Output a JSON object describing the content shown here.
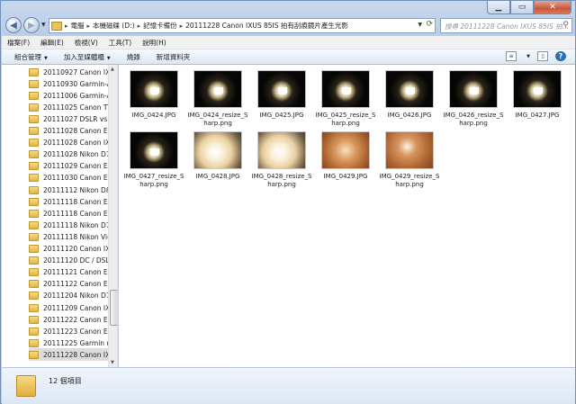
{
  "window": {
    "caption_buttons": [
      "minimize",
      "maximize",
      "close"
    ]
  },
  "address": {
    "crumbs": [
      "電腦",
      "本機磁碟 (D:)",
      "記憶卡備份",
      "20111228 Canon IXUS 85IS 拍有刮痕鏡片產生光影"
    ]
  },
  "search": {
    "placeholder": "搜尋 20111228 Canon IXUS 85IS 拍..."
  },
  "menu": {
    "items": [
      "檔案(F)",
      "編輯(E)",
      "檢視(V)",
      "工具(T)",
      "說明(H)"
    ]
  },
  "toolbar": {
    "organize": "組合管理",
    "add_to_library": "加入至媒體櫃",
    "burn": "燒錄",
    "new_folder": "新增資料夾"
  },
  "tree": {
    "items": [
      "20110927 Canon IX",
      "20110930 Garmin-A",
      "20111006 Garmin-A",
      "20111025 Canon TT",
      "20111027 DSLR vs D",
      "20111028 Canon EC",
      "20111028 Canon IX",
      "20111028 Nikon D7",
      "20111029 Canon EC",
      "20111030 Canon EC",
      "20111112 Nikon D8",
      "20111118 Canon EC",
      "20111118 Canon EC",
      "20111118 Nikon D7",
      "20111118 Nikon Vie",
      "20111120 Canon IX",
      "20111120 DC / DSLI",
      "20111121 Canon EC",
      "20111122 Canon EC",
      "20111204 Nikon D7",
      "20111209 Canon IX",
      "20111222 Canon EF",
      "20111223 Canon EF",
      "20111225 Garmin nu",
      "20111228 Canon IX"
    ],
    "selected_index": 24
  },
  "files": [
    {
      "name": "IMG_0424.JPG",
      "style": "dark"
    },
    {
      "name": "IMG_0424_resize_Sharp.png",
      "style": "dark"
    },
    {
      "name": "IMG_0425.JPG",
      "style": "dark"
    },
    {
      "name": "IMG_0425_resize_Sharp.png",
      "style": "dark"
    },
    {
      "name": "IMG_0426.JPG",
      "style": "dark"
    },
    {
      "name": "IMG_0426_resize_Sharp.png",
      "style": "dark"
    },
    {
      "name": "IMG_0427.JPG",
      "style": "dark"
    },
    {
      "name": "IMG_0427_resize_Sharp.png",
      "style": "dark"
    },
    {
      "name": "IMG_0428.JPG",
      "style": "bright"
    },
    {
      "name": "IMG_0428_resize_Sharp.png",
      "style": "bright"
    },
    {
      "name": "IMG_0429.JPG",
      "style": "warm"
    },
    {
      "name": "IMG_0429_resize_Sharp.png",
      "style": "warm2"
    }
  ],
  "status": {
    "item_count": "12 個項目"
  }
}
